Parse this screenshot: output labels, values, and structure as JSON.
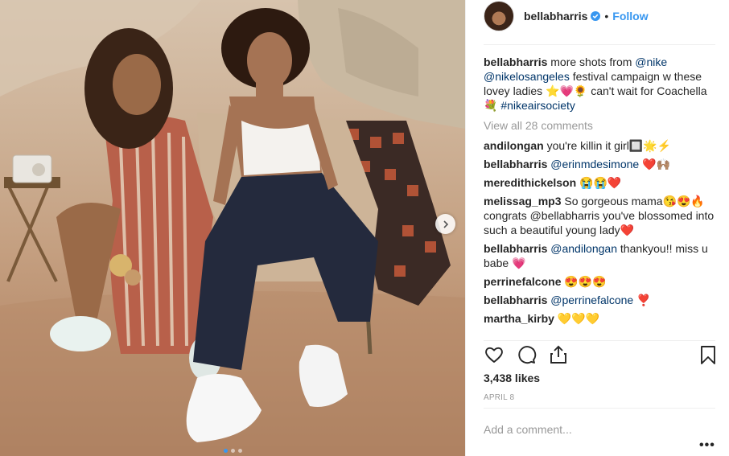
{
  "post": {
    "username": "bellabharris",
    "follow_label": "Follow",
    "separator": "•",
    "caption": {
      "user": "bellabharris",
      "text_1": "more shots from",
      "mention_1": "@nike",
      "mention_2": "@nikelosangeles",
      "text_2": "festival campaign w these lovey ladies ⭐💗🌻 can't wait for Coachella💐",
      "hashtag": "#nikeairsociety"
    },
    "view_all_label": "View all 28 comments",
    "comments": [
      {
        "user": "andilongan",
        "mention": "",
        "text": "you're killin it girl🔲🌟⚡"
      },
      {
        "user": "bellabharris",
        "mention": "@erinmdesimone",
        "text": "❤️🙌🏽"
      },
      {
        "user": "meredithickelson",
        "mention": "",
        "text": "😭😭❤️"
      },
      {
        "user": "melissag_mp3",
        "mention": "",
        "text": "So gorgeous mama😘😍🔥 congrats @bellabharris you've blossomed into such a beautiful young lady❤️"
      },
      {
        "user": "bellabharris",
        "mention": "@andilongan",
        "text": "thankyou!! miss u babe 💗"
      },
      {
        "user": "perrinefalcone",
        "mention": "",
        "text": "😍😍😍"
      },
      {
        "user": "bellabharris",
        "mention": "@perrinefalcone",
        "text": "❣️"
      },
      {
        "user": "martha_kirby",
        "mention": "",
        "text": "💛💛💛"
      }
    ],
    "likes": "3,438 likes",
    "date": "APRIL 8",
    "add_comment_placeholder": "Add a comment...",
    "more_label": "•••"
  },
  "icons": {
    "like": "heart-icon",
    "comment": "comment-icon",
    "share": "share-icon",
    "save": "bookmark-icon",
    "verified": "verified-badge-icon",
    "next": "chevron-right-icon"
  },
  "carousel": {
    "slides": 3,
    "active_index": 0
  },
  "colors": {
    "link": "#003569",
    "follow": "#3897f0",
    "muted": "#999999",
    "text": "#262626"
  }
}
